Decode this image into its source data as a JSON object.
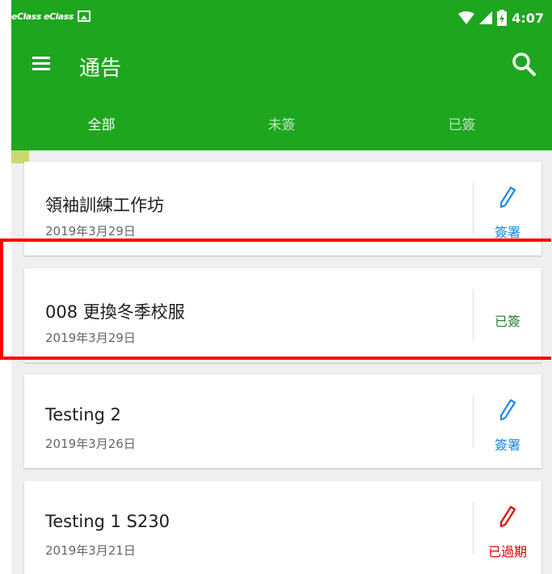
{
  "status_bar": {
    "left_labels": [
      "eClass",
      "eClass"
    ],
    "time": "4:07"
  },
  "toolbar": {
    "title": "通告",
    "menu_icon": "menu-icon",
    "search_icon": "search-icon"
  },
  "tabs": [
    {
      "label": "全部",
      "active": true
    },
    {
      "label": "未簽",
      "active": false
    },
    {
      "label": "已簽",
      "active": false
    }
  ],
  "colors": {
    "app_bar": "#1fa61f",
    "sign_blue": "#1e88e5",
    "signed_green": "#2e7d32",
    "expired_red": "#e00000",
    "highlight_red": "#ff0000"
  },
  "notices": [
    {
      "title": "領袖訓練工作坊",
      "date": "2019年3月29日",
      "action_label": "簽署",
      "action_icon": "pen-icon",
      "status": "sign"
    },
    {
      "title": "008 更換冬季校服",
      "date": "2019年3月29日",
      "action_label": "已簽",
      "action_icon": "",
      "status": "signed"
    },
    {
      "title": "Testing 2",
      "date": "2019年3月26日",
      "action_label": "簽署",
      "action_icon": "pen-icon",
      "status": "sign"
    },
    {
      "title": "Testing 1 S230",
      "date": "2019年3月21日",
      "action_label": "已過期",
      "action_icon": "pen-icon",
      "status": "expired"
    }
  ]
}
